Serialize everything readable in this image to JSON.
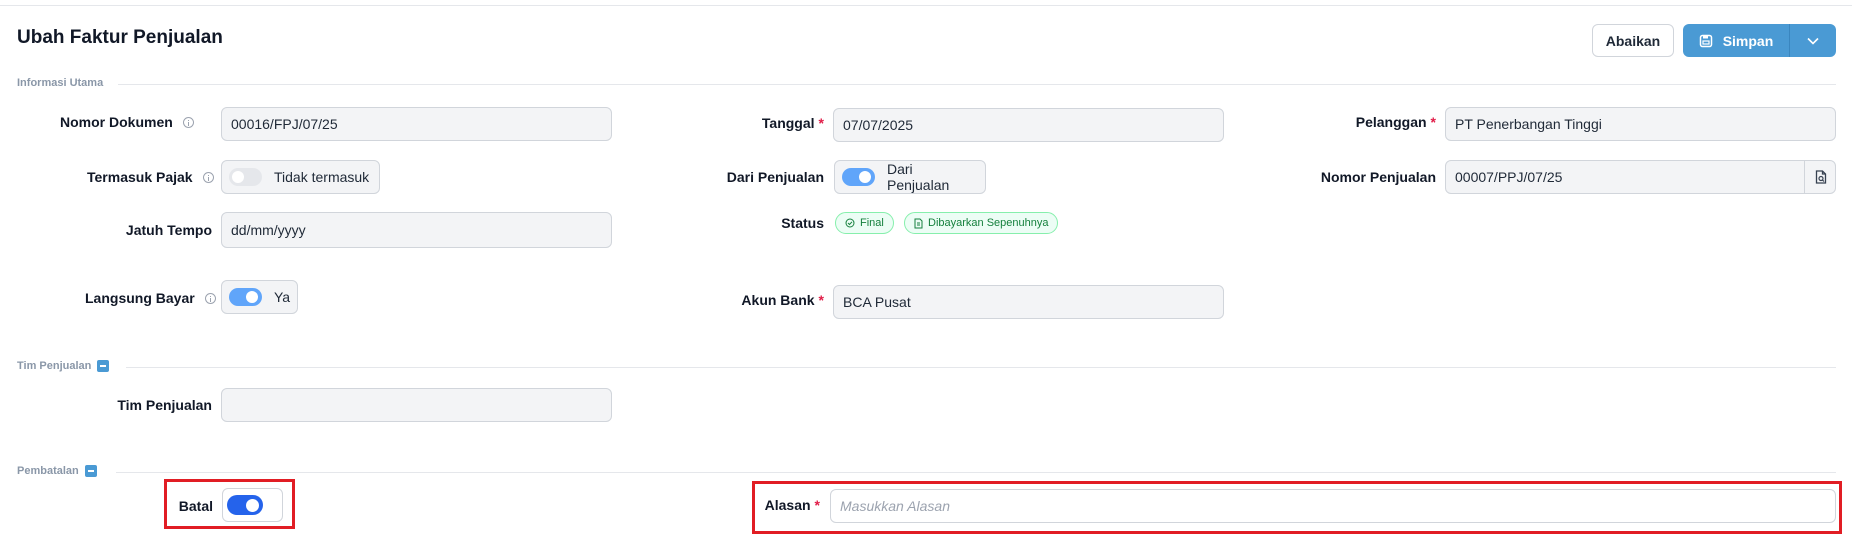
{
  "header": {
    "title": "Ubah Faktur Penjualan",
    "cancel_label": "Abaikan",
    "save_label": "Simpan"
  },
  "sections": {
    "main": "Informasi Utama",
    "team": "Tim Penjualan",
    "cancel": "Pembatalan"
  },
  "fields": {
    "doc_number": {
      "label": "Nomor Dokumen",
      "value": "00016/FPJ/07/25"
    },
    "date": {
      "label": "Tanggal",
      "value": "07/07/2025"
    },
    "customer": {
      "label": "Pelanggan",
      "value": "PT Penerbangan Tinggi"
    },
    "tax": {
      "label": "Termasuk Pajak",
      "value": "Tidak termasuk",
      "on": false
    },
    "from_sale": {
      "label": "Dari Penjualan",
      "value": "Dari Penjualan",
      "on": true
    },
    "sale_number": {
      "label": "Nomor Penjualan",
      "value": "00007/PPJ/07/25"
    },
    "due_date": {
      "label": "Jatuh Tempo",
      "placeholder": "dd/mm/yyyy"
    },
    "status": {
      "label": "Status",
      "badges": [
        "Final",
        "Dibayarkan Sepenuhnya"
      ]
    },
    "direct_pay": {
      "label": "Langsung Bayar",
      "value": "Ya",
      "on": true
    },
    "bank_account": {
      "label": "Akun Bank",
      "value": "BCA Pusat"
    },
    "sales_team": {
      "label": "Tim Penjualan",
      "value": ""
    },
    "cancelled": {
      "label": "Batal",
      "on": true
    },
    "reason": {
      "label": "Alasan",
      "placeholder": "Masukkan Alasan"
    }
  },
  "colors": {
    "primary": "#4a9ad4",
    "required": "#e11d48",
    "badge_green": "#15803d",
    "highlight": "#e11d24"
  }
}
